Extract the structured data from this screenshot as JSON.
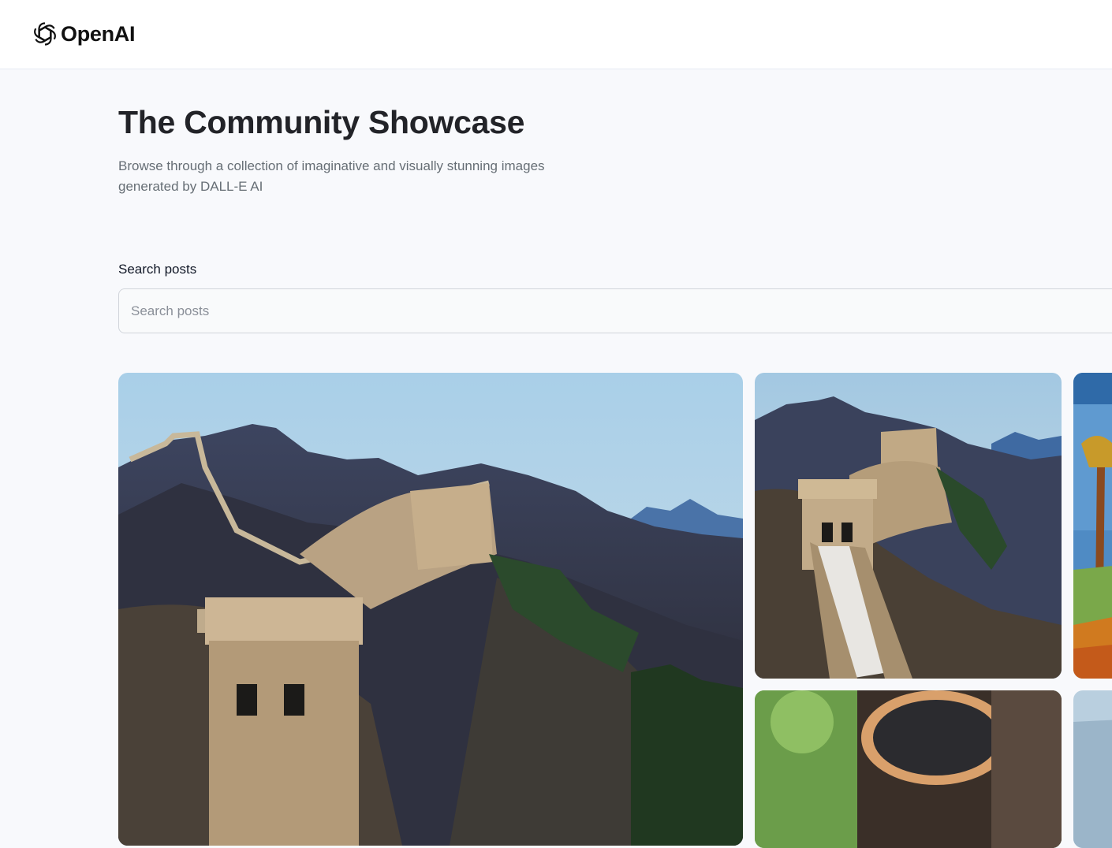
{
  "header": {
    "logo_text": "OpenAI",
    "logo_icon": "openai-logo-icon"
  },
  "hero": {
    "title": "The Community Showcase",
    "subtitle": "Browse through a collection of imaginative and visually stunning images generated by DALL-E AI"
  },
  "search": {
    "label": "Search posts",
    "placeholder": "Search posts",
    "value": ""
  },
  "gallery": {
    "cards": [
      {
        "subject": "great-wall-mountains"
      },
      {
        "subject": "great-wall-watchtower"
      },
      {
        "subject": "tree-landscape-painting"
      },
      {
        "subject": "person-sunglasses"
      },
      {
        "subject": "landscape"
      }
    ]
  },
  "colors": {
    "page_background": "#f8f9fc",
    "header_background": "#ffffff",
    "title": "#222328",
    "subtitle": "#666e75",
    "input_border": "#d1d5db",
    "input_background": "#f9fafb"
  }
}
